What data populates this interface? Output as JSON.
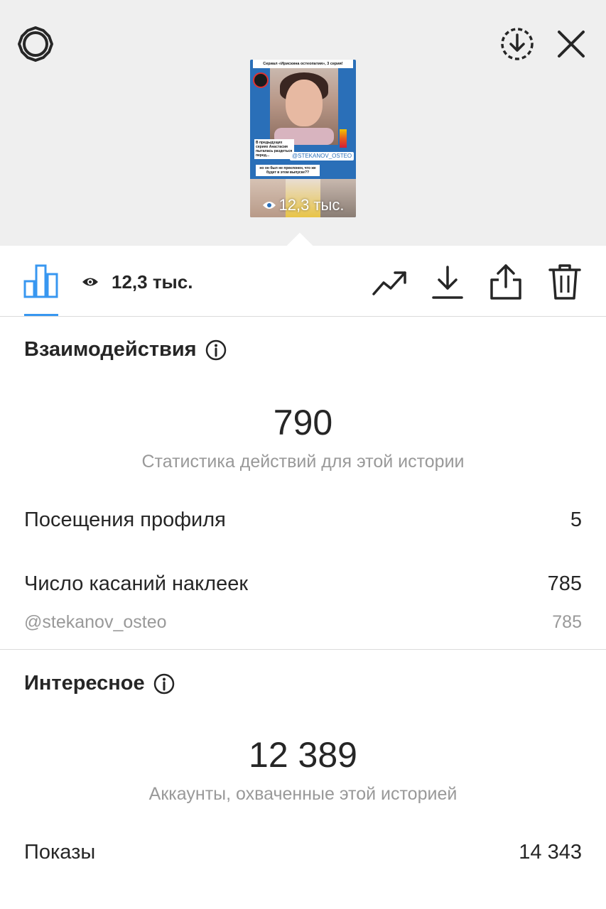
{
  "story": {
    "title": "Сериал «Ирискина остеопатия», 3 серия!",
    "caption_previous": "В предыдущих сериях Анастасия пыталась раздеться перед...",
    "mention": "@STEKANOV_OSTEO",
    "caption_question": "но он был не преклонен, что же будет в этом выпуске??",
    "views_overlay": "12,3 тыс."
  },
  "toolbar": {
    "views_count": "12,3 тыс."
  },
  "interactions": {
    "title": "Взаимодействия",
    "total": "790",
    "subtitle": "Статистика действий для этой истории",
    "rows": [
      {
        "label": "Посещения профиля",
        "value": "5"
      },
      {
        "label": "Число касаний наклеек",
        "value": "785"
      }
    ],
    "sticker_detail": {
      "label": "@stekanov_osteo",
      "value": "785"
    }
  },
  "discovery": {
    "title": "Интересное",
    "total": "12 389",
    "subtitle": "Аккаунты, охваченные этой историей",
    "rows": [
      {
        "label": "Показы",
        "value": "14 343"
      }
    ]
  },
  "colors": {
    "accent": "#3897f0",
    "text": "#262626",
    "secondary": "#999999",
    "top_bg": "#efefef"
  },
  "icons": [
    "settings-icon",
    "download-circle-icon",
    "close-icon",
    "insights-bar-icon",
    "eye-icon",
    "promote-trend-icon",
    "save-download-icon",
    "share-icon",
    "trash-icon",
    "info-icon"
  ]
}
